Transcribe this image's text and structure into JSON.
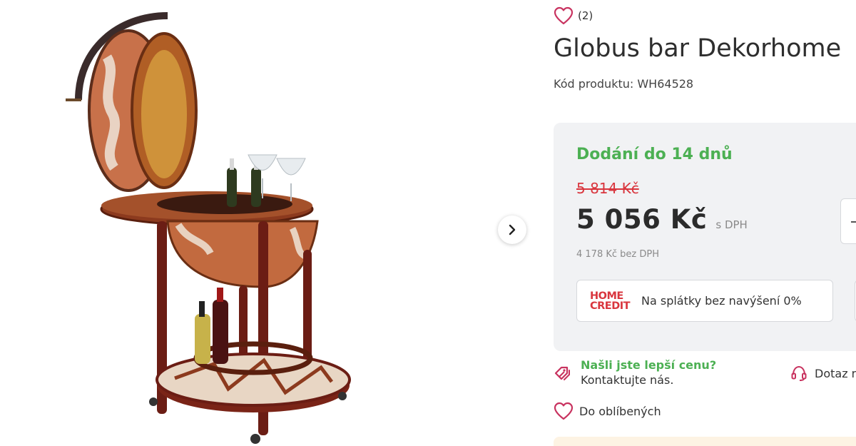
{
  "product": {
    "rating_count": "(2)",
    "title": "Globus bar Dekorhome",
    "sku_label": "Kód produktu:",
    "sku_value": "WH64528"
  },
  "pricing": {
    "delivery": "Dodání do 14 dnů",
    "old_price": "5 814 Kč",
    "price": "5 056 Kč",
    "vat_label": "s DPH",
    "price_without_vat": "4 178 Kč bez DPH"
  },
  "credit": {
    "logo_line1": "HOME",
    "logo_line2": "CREDIT",
    "text": "Na splátky bez navýšení 0%"
  },
  "links": {
    "better_price_title": "Našli jste lepší cenu?",
    "better_price_sub": "Kontaktujte nás.",
    "help_text": "Dotaz n",
    "wishlist": "Do oblíbených"
  },
  "colors": {
    "accent_green": "#4cb053",
    "accent_red": "#d9363e",
    "heart": "#c8325f",
    "panel_bg": "#f1f2f4"
  },
  "icons": {
    "rating": "heart-icon",
    "next": "chevron-right-icon",
    "better_price": "price-tag-icon",
    "help": "headset-icon",
    "wishlist": "heart-icon"
  }
}
